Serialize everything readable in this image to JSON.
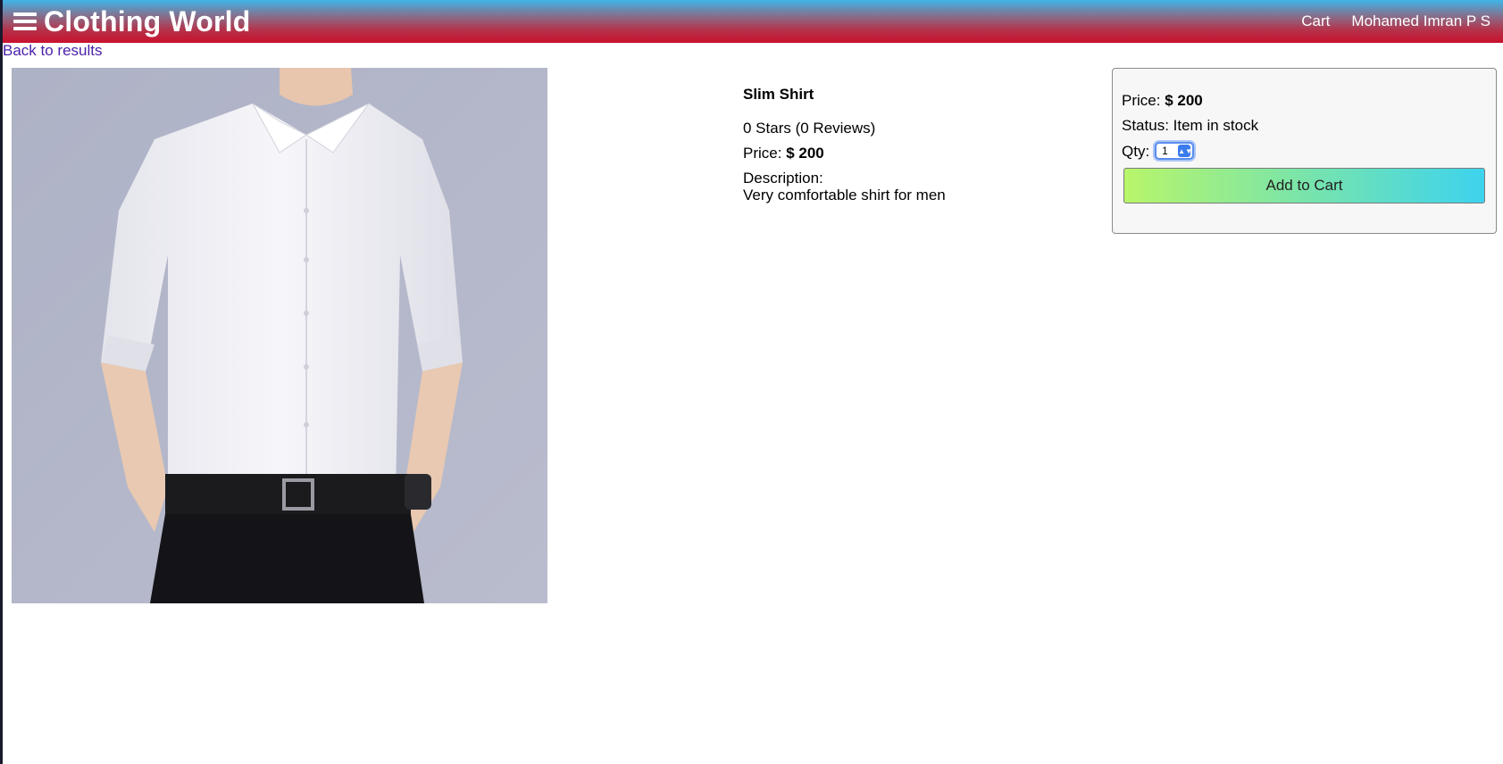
{
  "header": {
    "brand": "Clothing World",
    "menu_icon": "hamburger-icon",
    "links": {
      "cart": "Cart",
      "user": "Mohamed Imran P S"
    },
    "colors": {
      "gradient_top": "#3fb6e8",
      "gradient_bottom": "#c8102e"
    }
  },
  "navigation": {
    "back_link": "Back to results"
  },
  "product": {
    "name": "Slim Shirt",
    "rating": "0 Stars (0 Reviews)",
    "price_label": "Price:",
    "price_value": "$ 200",
    "description_label": "Description:",
    "description": "Very comfortable shirt for men"
  },
  "purchase": {
    "price_label": "Price:",
    "price_value": "$ 200",
    "status_label": "Status:",
    "status_value": "Item in stock",
    "qty_label": "Qty:",
    "qty_value": "1",
    "add_to_cart": "Add to Cart"
  }
}
